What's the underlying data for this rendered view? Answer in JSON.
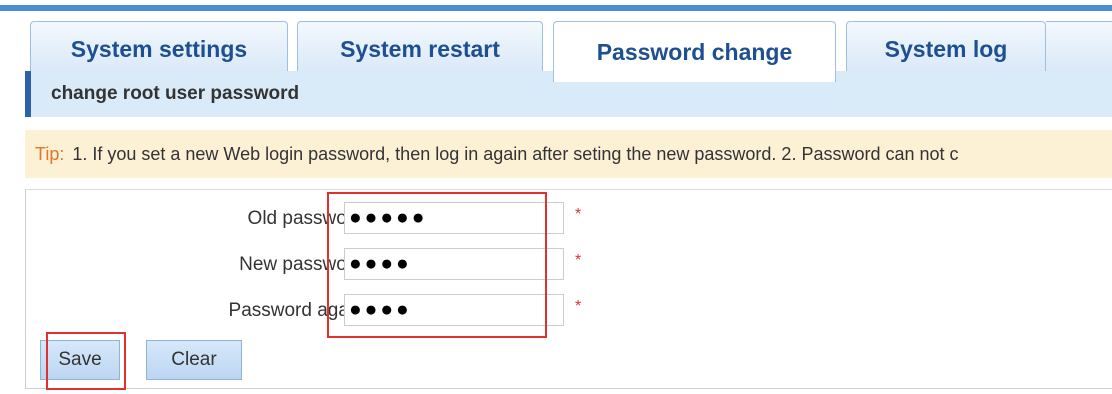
{
  "tabs": [
    {
      "label": "System settings"
    },
    {
      "label": "System restart"
    },
    {
      "label": "Password change",
      "active": true
    },
    {
      "label": "System log"
    }
  ],
  "section": {
    "title": "change root user password"
  },
  "tip": {
    "label": "Tip:",
    "text": "1. If you set a new Web login password, then log in again after seting the new password.   2. Password can not c"
  },
  "form": {
    "old_password_label": "Old password:",
    "old_password_value": "●●●●●",
    "new_password_label": "New password:",
    "new_password_value": "●●●●",
    "again_label": "Password again:",
    "again_value": "●●●●",
    "required_mark": "*"
  },
  "buttons": {
    "save": "Save",
    "clear": "Clear"
  },
  "colors": {
    "accent": "#2c63a7",
    "tab_text": "#1d4f91",
    "tip_label": "#e0762b",
    "required": "#e03131"
  }
}
